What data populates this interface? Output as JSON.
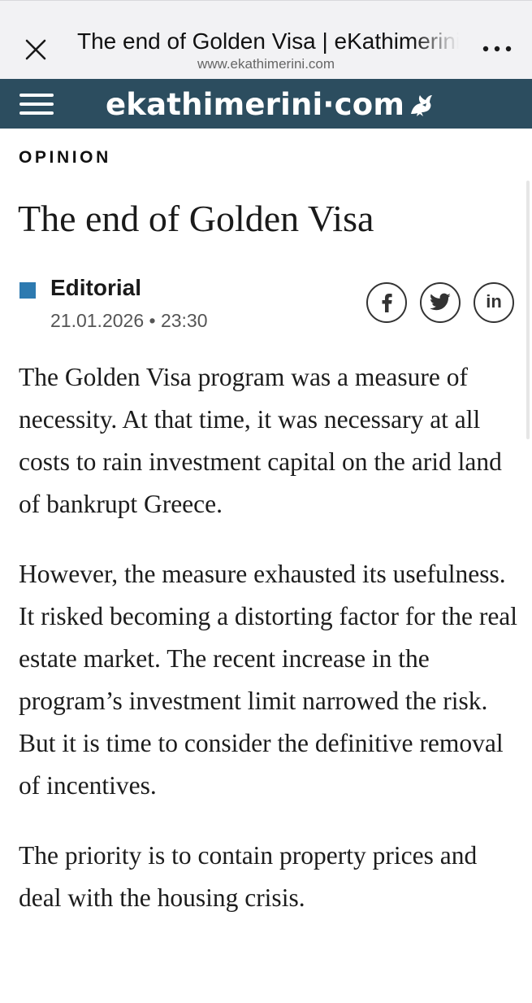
{
  "browser": {
    "tab_title": "The end of Golden Visa | eKathimerini.com",
    "url": "www.ekathimerini.com",
    "close_icon": "close-icon",
    "more_icon": "more-icon"
  },
  "site_header": {
    "logo_text": "ekathimerini·com",
    "menu_icon": "hamburger-menu-icon",
    "background_color": "#2c4d5f"
  },
  "article": {
    "section": "OPINION",
    "title": "The end of Golden Visa",
    "author": "Editorial",
    "author_accent_color": "#2d7ab0",
    "date": "21.01.2026 • 23:30",
    "share": {
      "facebook": "f",
      "twitter_icon": "twitter-icon",
      "linkedin": "in"
    },
    "paragraphs": [
      "The Golden Visa program was a measure of necessity. At that time, it was necessary at all costs to rain investment capital on the arid land of bankrupt Greece.",
      "However, the measure exhausted its usefulness. It risked becoming a distorting factor for the real estate market. The recent increase in the program’s investment limit narrowed the risk. But it is time to consider the definitive removal of incentives.",
      "The priority is to contain property prices and deal with the housing crisis."
    ]
  }
}
